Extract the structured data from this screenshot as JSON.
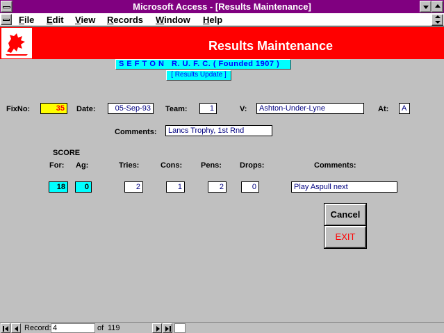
{
  "window": {
    "title": "Microsoft Access - [Results Maintenance]"
  },
  "menubar": {
    "items": [
      "File",
      "Edit",
      "View",
      "Records",
      "Window",
      "Help"
    ],
    "underline": [
      "F",
      "E",
      "V",
      "R",
      "W",
      "H"
    ]
  },
  "header": {
    "title": "Results Maintenance",
    "club": "S E F T O N   R. U. F. C. ( Founded 1907 )",
    "subtitle": "[ Results Update ]"
  },
  "form": {
    "fixno_label": "FixNo:",
    "fixno": "35",
    "date_label": "Date:",
    "date": "05-Sep-93",
    "team_label": "Team:",
    "team": "1",
    "v_label": "V:",
    "opponent": "Ashton-Under-Lyne",
    "at_label": "At:",
    "at": "A",
    "comments_label": "Comments:",
    "comments": "Lancs Trophy, 1st Rnd"
  },
  "score": {
    "heading": "SCORE",
    "for_label": "For:",
    "ag_label": "Ag:",
    "tries_label": "Tries:",
    "cons_label": "Cons:",
    "pens_label": "Pens:",
    "drops_label": "Drops:",
    "comments_label": "Comments:",
    "for": "18",
    "ag": "0",
    "tries": "2",
    "cons": "1",
    "pens": "2",
    "drops": "0",
    "comments": "Play Aspull next"
  },
  "buttons": {
    "cancel": "Cancel",
    "exit": "EXIT"
  },
  "statusbar": {
    "record_label": "Record:",
    "record": "4",
    "of_label": "of",
    "total": "119"
  },
  "colors": {
    "titlebar": "#800080",
    "header": "#ff0000",
    "highlight": "#00ffff",
    "fixno": "#ffff00"
  }
}
